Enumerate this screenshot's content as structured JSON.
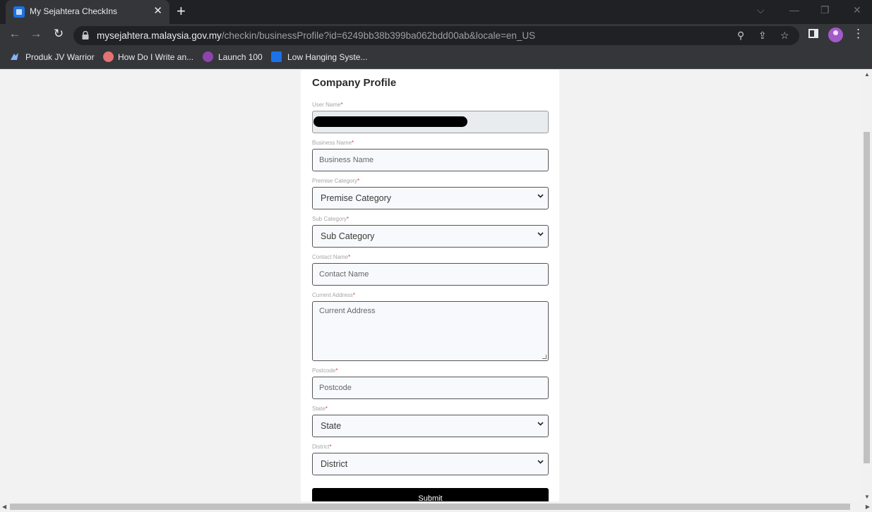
{
  "browser": {
    "tab_title": "My Sejahtera CheckIns",
    "tab_close": "✕",
    "new_tab": "+",
    "url_host": "mysejahtera.malaysia.gov.my",
    "url_path": "/checkin/businessProfile?id=6249bb38b399ba062bdd00ab&locale=en_US",
    "bookmarks": [
      {
        "label": "Produk JV Warrior"
      },
      {
        "label": "How Do I Write an..."
      },
      {
        "label": "Launch 100"
      },
      {
        "label": "Low Hanging Syste..."
      }
    ]
  },
  "form": {
    "title": "Company Profile",
    "required_marker": "*",
    "user_name": {
      "label": "User Name"
    },
    "business_name": {
      "label": "Business Name",
      "placeholder": "Business Name"
    },
    "premise_category": {
      "label": "Premise Category",
      "value": "Premise Category"
    },
    "sub_category": {
      "label": "Sub Category",
      "value": "Sub Category"
    },
    "contact_name": {
      "label": "Contact Name",
      "placeholder": "Contact Name"
    },
    "current_address": {
      "label": "Current Address",
      "placeholder": "Current Address"
    },
    "postcode": {
      "label": "Postcode",
      "placeholder": "Postcode"
    },
    "state": {
      "label": "State",
      "value": "State"
    },
    "district": {
      "label": "District",
      "value": "District"
    },
    "submit_label": "Submit"
  }
}
